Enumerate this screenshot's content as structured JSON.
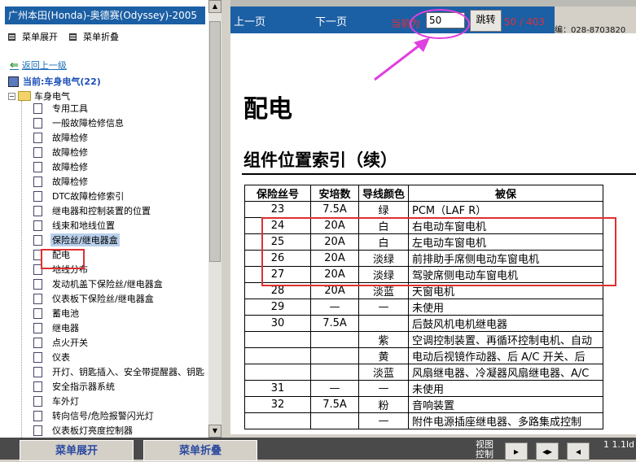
{
  "window_title": "广州本田(Honda)-奥德赛(Odyssey)-2005",
  "menu": {
    "expand": "菜单展开",
    "collapse": "菜单折叠"
  },
  "back_link": "返回上一级",
  "current_node": "当前:车身电气(22)",
  "root_node": "车身电气",
  "tree_items": [
    "专用工具",
    "一般故障检修信息",
    "故障检修",
    "故障检修",
    "故障检修",
    "故障检修",
    "DTC故障检修索引",
    "继电器和控制装置的位置",
    "线束和地线位置",
    "保险丝/继电器盒",
    "配电",
    "地线分布",
    "发动机盖下保险丝/继电器盒",
    "仪表板下保险丝/继电器盒",
    "蓄电池",
    "继电器",
    "点火开关",
    "仪表",
    "开灯、钥匙插入、安全带提醒器、钥匙",
    "安全指示器系统",
    "车外灯",
    "转向信号/危险报警闪光灯",
    "仪表板灯亮度控制器"
  ],
  "toolbar": {
    "prev": "上一页",
    "next": "下一页",
    "current_label": "当前为",
    "page_value": "50",
    "jump": "跳转",
    "page_count": "50 / 403"
  },
  "behind_text": "编：028-8703820",
  "document": {
    "heading": "配电",
    "subheading": "组件位置索引（续）",
    "table_headers": [
      "保险丝号",
      "安培数",
      "导线颜色",
      "被保"
    ],
    "rows": [
      [
        "23",
        "7.5A",
        "绿",
        "PCM（LAF R）"
      ],
      [
        "24",
        "20A",
        "白",
        "右电动车窗电机"
      ],
      [
        "25",
        "20A",
        "白",
        "左电动车窗电机"
      ],
      [
        "26",
        "20A",
        "淡绿",
        "前排助手席侧电动车窗电机"
      ],
      [
        "27",
        "20A",
        "淡绿",
        "驾驶席侧电动车窗电机"
      ],
      [
        "28",
        "20A",
        "淡蓝",
        "天窗电机"
      ],
      [
        "29",
        "—",
        "—",
        "未使用"
      ],
      [
        "30",
        "7.5A",
        "",
        "后鼓风机电机继电器"
      ],
      [
        "",
        "",
        "紫",
        "空调控制装置、再循环控制电机、自动"
      ],
      [
        "",
        "",
        "黄",
        "电动后视镜作动器、后 A/C 开关、后"
      ],
      [
        "",
        "",
        "淡蓝",
        "风扇继电器、冷凝器风扇继电器、A/C"
      ],
      [
        "31",
        "—",
        "—",
        "未使用"
      ],
      [
        "32",
        "7.5A",
        "粉",
        "音响装置"
      ],
      [
        "",
        "",
        "—",
        "附件电源插座继电器、多路集成控制"
      ]
    ]
  },
  "bottom": {
    "expand": "菜单展开",
    "collapse": "菜单折叠",
    "view_label": "视图控制",
    "page_indicator": "1  1.1ld"
  },
  "colors": {
    "accent": "#1b5fa4",
    "highlight_red": "#e03030",
    "marker_magenta": "#e040e0"
  }
}
